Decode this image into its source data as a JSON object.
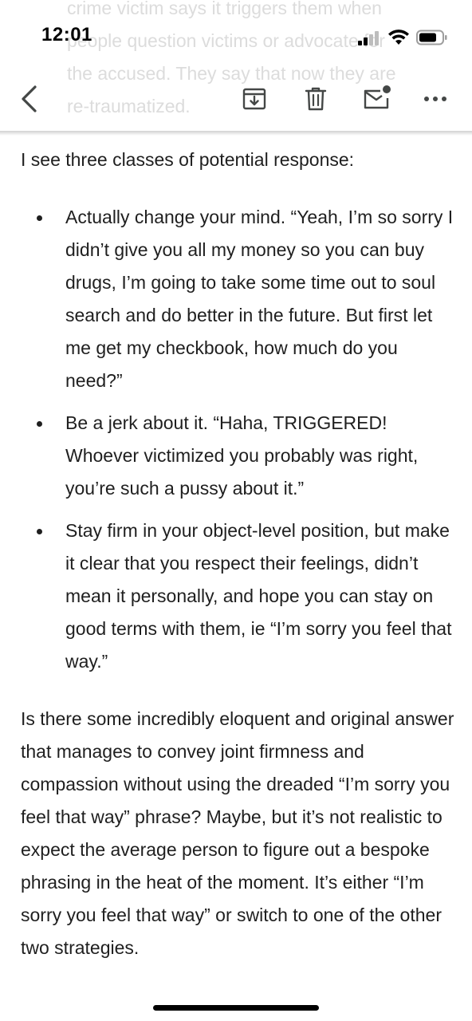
{
  "status_bar": {
    "time": "12:01"
  },
  "ghost_text": {
    "lines": [
      "crime victim says it triggers them when",
      "people question victims or advocate for",
      "the accused. They say that now they are",
      "re-traumatized."
    ]
  },
  "toolbar": {
    "icons": [
      "back-icon",
      "archive-icon",
      "trash-icon",
      "mark-unread-icon",
      "more-icon"
    ]
  },
  "content": {
    "intro": "I see three classes of potential response:",
    "bullets": [
      "Actually change your mind. “Yeah, I’m so sorry I didn’t give you all my money so you can buy drugs, I’m going to take some time out to soul search and do better in the future. But first let me get my checkbook, how much do you need?”",
      "Be a jerk about it. “Haha, TRIGGERED! Whoever victimized you probably was right, you’re such a pussy about it.”",
      "Stay firm in your object-level position, but make it clear that you respect their feelings, didn’t mean it personally, and hope you can stay on good terms with them, ie “I’m sorry you feel that way.”"
    ],
    "closing": "Is there some incredibly eloquent and original answer that manages to convey joint firmness and compassion without using the dreaded “I’m sorry you feel that way” phrase? Maybe, but it’s not realistic to expect the average person to figure out a bespoke phrasing in the heat of the moment. It’s either “I’m sorry you feel that way” or switch to one of the other two strategies."
  },
  "colors": {
    "text": "#1f1f1f",
    "ghost_text": "#dcdcdc",
    "icon": "#444746",
    "background": "#ffffff"
  }
}
